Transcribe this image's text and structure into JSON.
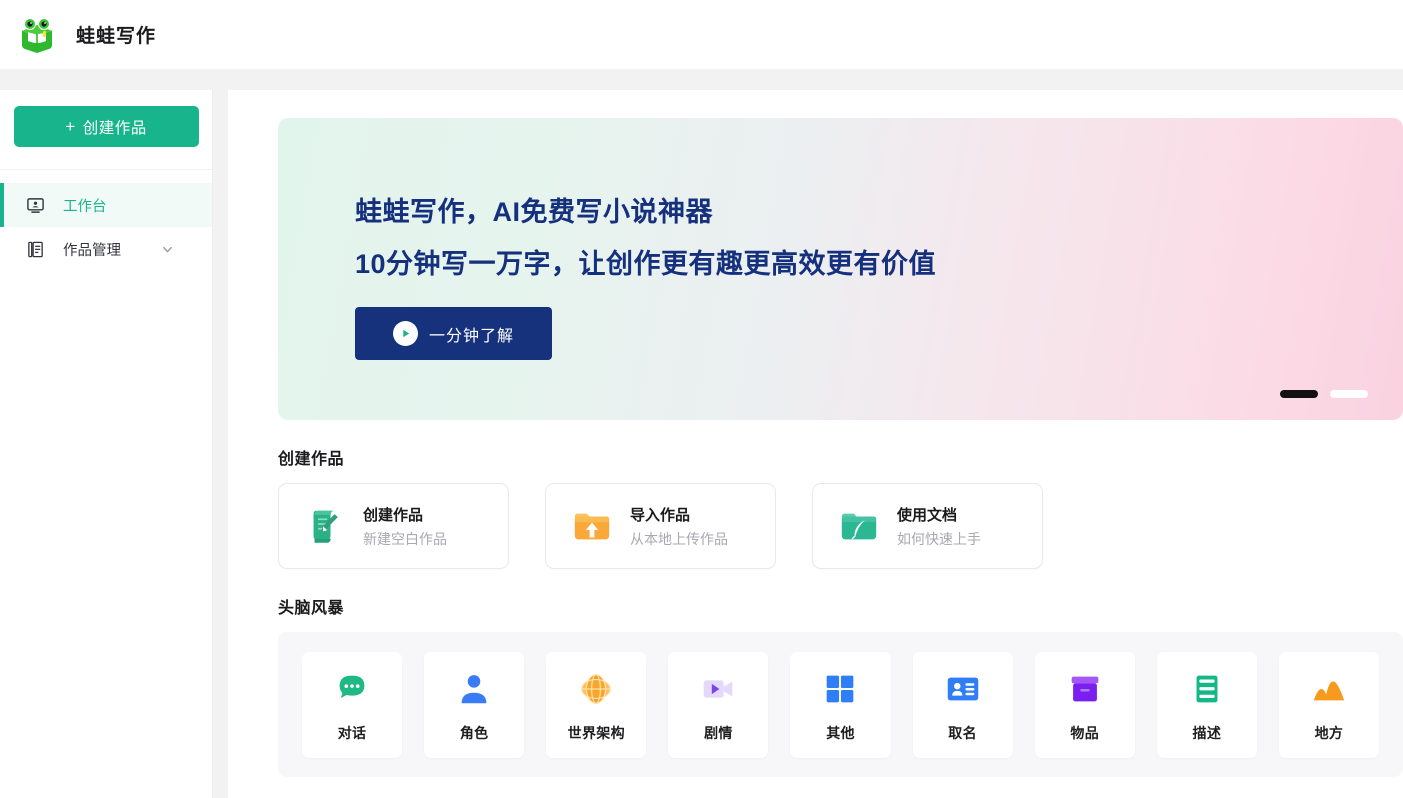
{
  "header": {
    "brand": "蛙蛙写作",
    "logo_icon": "frog-book-logo"
  },
  "sidebar": {
    "create_button": {
      "label": "创建作品",
      "plus": "+",
      "icon": "plus-icon"
    },
    "items": [
      {
        "label": "工作台",
        "icon": "workbench-monitor-icon",
        "active": true
      },
      {
        "label": "作品管理",
        "icon": "document-list-icon",
        "active": false,
        "chevron": "chevron-down-icon"
      }
    ]
  },
  "banner": {
    "line1": "蛙蛙写作，AI免费写小说神器",
    "line2": "10分钟写一万字，让创作更有趣更高效更有价值",
    "cta_label": "一分钟了解",
    "cta_icon": "play-circle-icon",
    "dots": [
      {
        "active": true
      },
      {
        "active": false
      }
    ],
    "gradient_from": "#e2f5ec",
    "gradient_to": "#fad2e0",
    "text_color": "#15307d",
    "cta_bg": "#16327d"
  },
  "create_section": {
    "title": "创建作品",
    "cards": [
      {
        "title": "创建作品",
        "subtitle": "新建空白作品",
        "icon": "scroll-pen-icon",
        "color": "#25b285"
      },
      {
        "title": "导入作品",
        "subtitle": "从本地上传作品",
        "icon": "folder-upload-icon",
        "color": "#f9a938"
      },
      {
        "title": "使用文档",
        "subtitle": "如何快速上手",
        "icon": "folder-feather-icon",
        "color": "#2bb792"
      }
    ]
  },
  "brainstorm": {
    "title": "头脑风暴",
    "tiles": [
      {
        "label": "对话",
        "icon": "chat-bubble-icon",
        "color": "#1fb983"
      },
      {
        "label": "角色",
        "icon": "user-person-icon",
        "color": "#3b7cf6"
      },
      {
        "label": "世界架构",
        "icon": "globe-icon",
        "color": "#f79a1e"
      },
      {
        "label": "剧情",
        "icon": "video-camera-icon",
        "color": "#9b6cf0"
      },
      {
        "label": "其他",
        "icon": "grid-squares-icon",
        "color": "#2f7ef5"
      },
      {
        "label": "取名",
        "icon": "id-card-icon",
        "color": "#2f7ef5"
      },
      {
        "label": "物品",
        "icon": "box-container-icon",
        "color": "#8a2ff0"
      },
      {
        "label": "描述",
        "icon": "text-lines-icon",
        "color": "#13b887"
      },
      {
        "label": "地方",
        "icon": "mountain-icon",
        "color": "#f79a1e"
      }
    ]
  },
  "theme": {
    "accent": "#18b58d",
    "navy": "#15307d",
    "page_bg": "#f2f2f3"
  }
}
